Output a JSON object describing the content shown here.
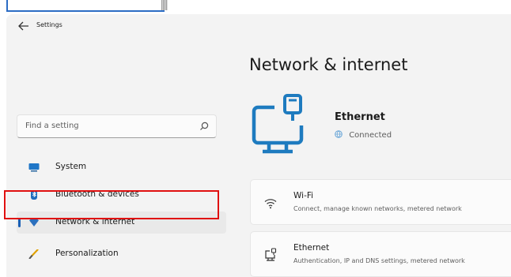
{
  "app": {
    "title": "Settings"
  },
  "search": {
    "placeholder": "Find a setting"
  },
  "sidebar": {
    "items": [
      {
        "label": "System",
        "icon": "monitor-icon"
      },
      {
        "label": "Bluetooth & devices",
        "icon": "bluetooth-icon"
      },
      {
        "label": "Network & internet",
        "icon": "wifi-icon",
        "active": true
      },
      {
        "label": "Personalization",
        "icon": "brush-icon"
      }
    ]
  },
  "main": {
    "title": "Network & internet",
    "hero": {
      "name": "Ethernet",
      "status": "Connected",
      "icon": "ethernet-computer-icon"
    },
    "cards": [
      {
        "title": "Wi-Fi",
        "subtitle": "Connect, manage known networks, metered network",
        "icon": "wifi-icon"
      },
      {
        "title": "Ethernet",
        "subtitle": "Authentication, IP and DNS settings, metered network",
        "icon": "ethernet-icon"
      }
    ]
  },
  "colors": {
    "accent": "#1a5fb4",
    "highlight": "#e01010",
    "hero_icon": "#1e7bbf"
  }
}
